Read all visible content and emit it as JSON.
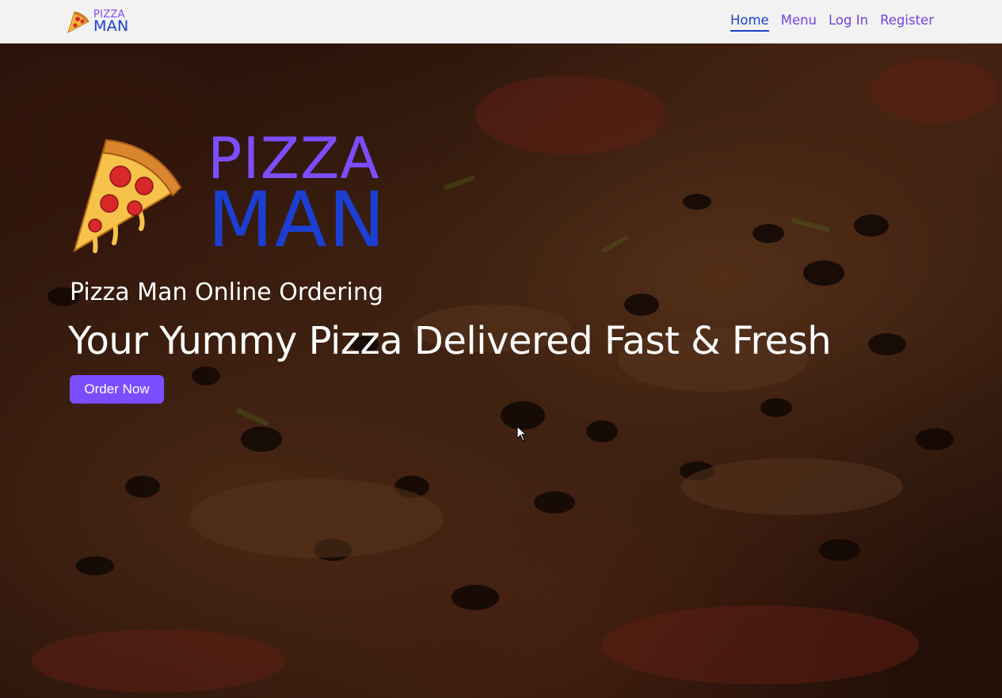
{
  "navbar": {
    "brand": {
      "line1": "PIZZA",
      "line2": "MAN",
      "icon": "pizza-slice-icon"
    },
    "links": [
      {
        "label": "Home",
        "active": true
      },
      {
        "label": "Menu",
        "active": false
      },
      {
        "label": "Log In",
        "active": false
      },
      {
        "label": "Register",
        "active": false
      }
    ]
  },
  "hero": {
    "logo": {
      "line1": "PIZZA",
      "line2": "MAN",
      "icon": "pizza-slice-icon"
    },
    "subtitle": "Pizza Man Online Ordering",
    "headline": "Your Yummy Pizza Delivered Fast & Fresh",
    "cta_label": "Order Now",
    "background": "pizza-photo"
  },
  "colors": {
    "accent_purple": "#7c4dff",
    "brand_blue": "#1b3fd1",
    "navbar_bg": "#f2f2f2",
    "hero_text": "#ffffff"
  }
}
